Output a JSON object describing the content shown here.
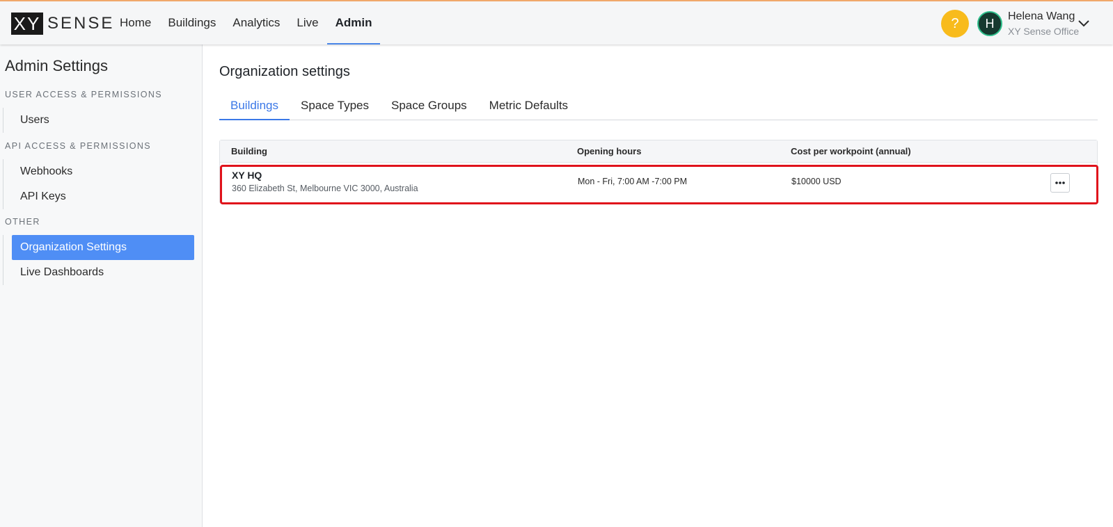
{
  "header": {
    "logo_mark": "XY",
    "logo_text": "SENSE",
    "nav": [
      {
        "label": "Home"
      },
      {
        "label": "Buildings"
      },
      {
        "label": "Analytics"
      },
      {
        "label": "Live"
      },
      {
        "label": "Admin",
        "active": true
      }
    ],
    "help_label": "?",
    "user": {
      "initial": "H",
      "name": "Helena Wang",
      "org": "XY Sense Office"
    }
  },
  "sidebar": {
    "title": "Admin Settings",
    "sections": [
      {
        "heading": "USER ACCESS & PERMISSIONS",
        "items": [
          {
            "label": "Users"
          }
        ]
      },
      {
        "heading": "API ACCESS & PERMISSIONS",
        "items": [
          {
            "label": "Webhooks"
          },
          {
            "label": "API Keys"
          }
        ]
      },
      {
        "heading": "OTHER",
        "items": [
          {
            "label": "Organization Settings",
            "active": true
          },
          {
            "label": "Live Dashboards"
          }
        ]
      }
    ]
  },
  "main": {
    "title": "Organization settings",
    "tabs": [
      {
        "label": "Buildings",
        "active": true
      },
      {
        "label": "Space Types"
      },
      {
        "label": "Space Groups"
      },
      {
        "label": "Metric Defaults"
      }
    ],
    "table": {
      "columns": [
        "Building",
        "Opening hours",
        "Cost per workpoint (annual)"
      ],
      "rows": [
        {
          "name": "XY HQ",
          "address": "360 Elizabeth St, Melbourne VIC 3000, Australia",
          "hours": "Mon - Fri, 7:00 AM -7:00 PM",
          "cost": "$10000 USD"
        }
      ]
    }
  },
  "colors": {
    "accent": "#4f8ef5",
    "tab_active": "#3b78e7",
    "help": "#f8bb1c",
    "highlight": "#e0121b",
    "avatar_bg": "#16392f"
  },
  "icons": [
    "help-icon",
    "avatar",
    "chevron-down-icon",
    "more-horizontal-icon"
  ]
}
